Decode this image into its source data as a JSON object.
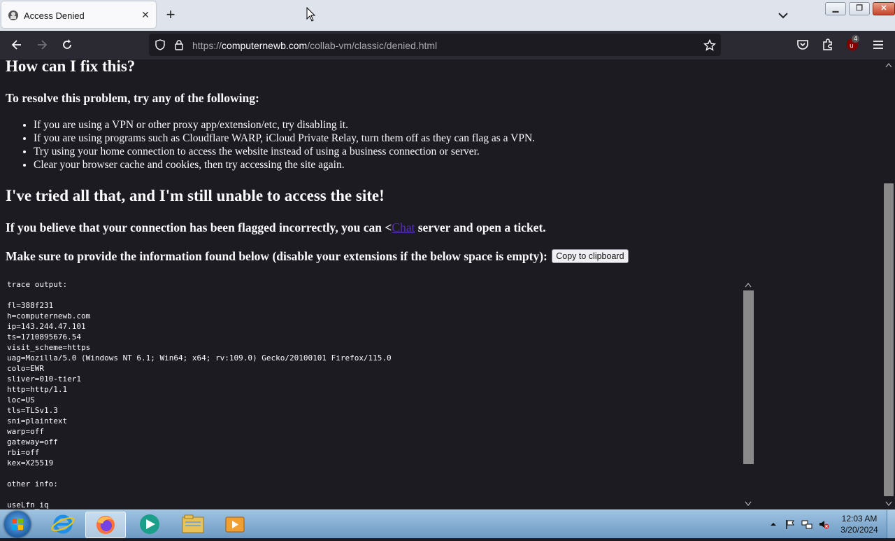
{
  "browser": {
    "tab_title": "Access Denied",
    "url_prefix": "https://",
    "url_host": "computernewb.com",
    "url_path": "/collab-vm/classic/denied.html",
    "extension_badge": "4"
  },
  "page": {
    "fix_heading": "How can I fix this?",
    "resolve_heading": "To resolve this problem, try any of the following:",
    "fixes": [
      "If you are using a VPN or other proxy app/extension/etc, try disabling it.",
      "If you are using programs such as Cloudflare WARP, iCloud Private Relay, turn them off as they can flag as a VPN.",
      "Try using your home connection to access the website instead of using a business connection or server.",
      "Clear your browser cache and cookies, then try accessing the site again."
    ],
    "still_heading": "I've tried all that, and I'm still unable to access the site!",
    "flagged_before": "If you believe that your connection has been flagged incorrectly, you can <",
    "chat_link": "Chat",
    "flagged_after": " server and open a ticket.",
    "provide_text": "Make sure to provide the information found below (disable your extensions if the below space is empty):",
    "copy_button": "Copy to clipboard",
    "trace_text": "trace output:\n\nfl=388f231\nh=computernewb.com\nip=143.244.47.101\nts=1710895676.54\nvisit_scheme=https\nuag=Mozilla/5.0 (Windows NT 6.1; Win64; x64; rv:109.0) Gecko/20100101 Firefox/115.0\ncolo=EWR\nsliver=010-tier1\nhttp=http/1.1\nloc=US\ntls=TLSv1.3\nsni=plaintext\nwarp=off\ngateway=off\nrbi=off\nkex=X25519\n\nother info:\n\nuseLfn_iq"
  },
  "taskbar": {
    "time": "12:03 AM",
    "date": "3/20/2024"
  },
  "colors": {
    "page_bg": "#1c1b22",
    "toolbar_bg": "#2b2a33",
    "tabbar_bg": "#dfe4ec",
    "link": "#5a2fb5"
  }
}
